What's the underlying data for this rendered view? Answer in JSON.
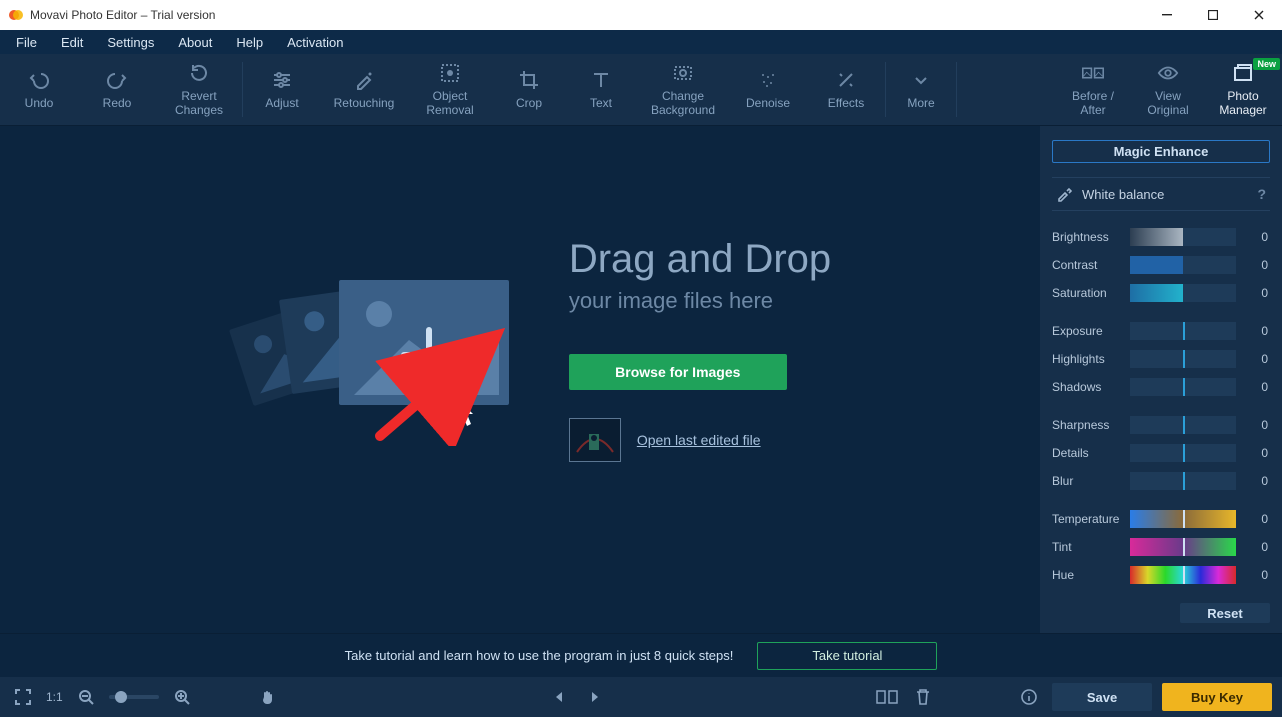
{
  "window": {
    "title": "Movavi Photo Editor – Trial version"
  },
  "menu": [
    "File",
    "Edit",
    "Settings",
    "About",
    "Help",
    "Activation"
  ],
  "toolbar": {
    "undo": "Undo",
    "redo": "Redo",
    "revert": "Revert\nChanges",
    "adjust": "Adjust",
    "retouching": "Retouching",
    "object_removal": "Object\nRemoval",
    "crop": "Crop",
    "text": "Text",
    "change_bg": "Change\nBackground",
    "denoise": "Denoise",
    "effects": "Effects",
    "more": "More",
    "before_after": "Before /\nAfter",
    "view_original": "View\nOriginal",
    "photo_manager": "Photo\nManager",
    "new_badge": "New"
  },
  "canvas": {
    "heading": "Drag and Drop",
    "sub": "your image files here",
    "browse": "Browse for Images",
    "open_last": "Open last edited file"
  },
  "sidebar": {
    "magic": "Magic Enhance",
    "white_balance": "White balance",
    "sliders_a": [
      {
        "name": "Brightness",
        "value": 0,
        "variant": "brightness"
      },
      {
        "name": "Contrast",
        "value": 0,
        "variant": "contrast"
      },
      {
        "name": "Saturation",
        "value": 0,
        "variant": "saturation"
      }
    ],
    "sliders_b": [
      {
        "name": "Exposure",
        "value": 0,
        "variant": "plain"
      },
      {
        "name": "Highlights",
        "value": 0,
        "variant": "plain"
      },
      {
        "name": "Shadows",
        "value": 0,
        "variant": "plain"
      }
    ],
    "sliders_c": [
      {
        "name": "Sharpness",
        "value": 0,
        "variant": "plain"
      },
      {
        "name": "Details",
        "value": 0,
        "variant": "plain"
      },
      {
        "name": "Blur",
        "value": 0,
        "variant": "plain"
      }
    ],
    "sliders_d": [
      {
        "name": "Temperature",
        "value": 0,
        "variant": "temp mark"
      },
      {
        "name": "Tint",
        "value": 0,
        "variant": "tint mark"
      },
      {
        "name": "Hue",
        "value": 0,
        "variant": "hue mark"
      }
    ],
    "reset": "Reset"
  },
  "tutorial": {
    "text": "Take tutorial and learn how to use the program in just 8 quick steps!",
    "button": "Take tutorial"
  },
  "status": {
    "ratio": "1:1",
    "save": "Save",
    "buy": "Buy Key"
  }
}
